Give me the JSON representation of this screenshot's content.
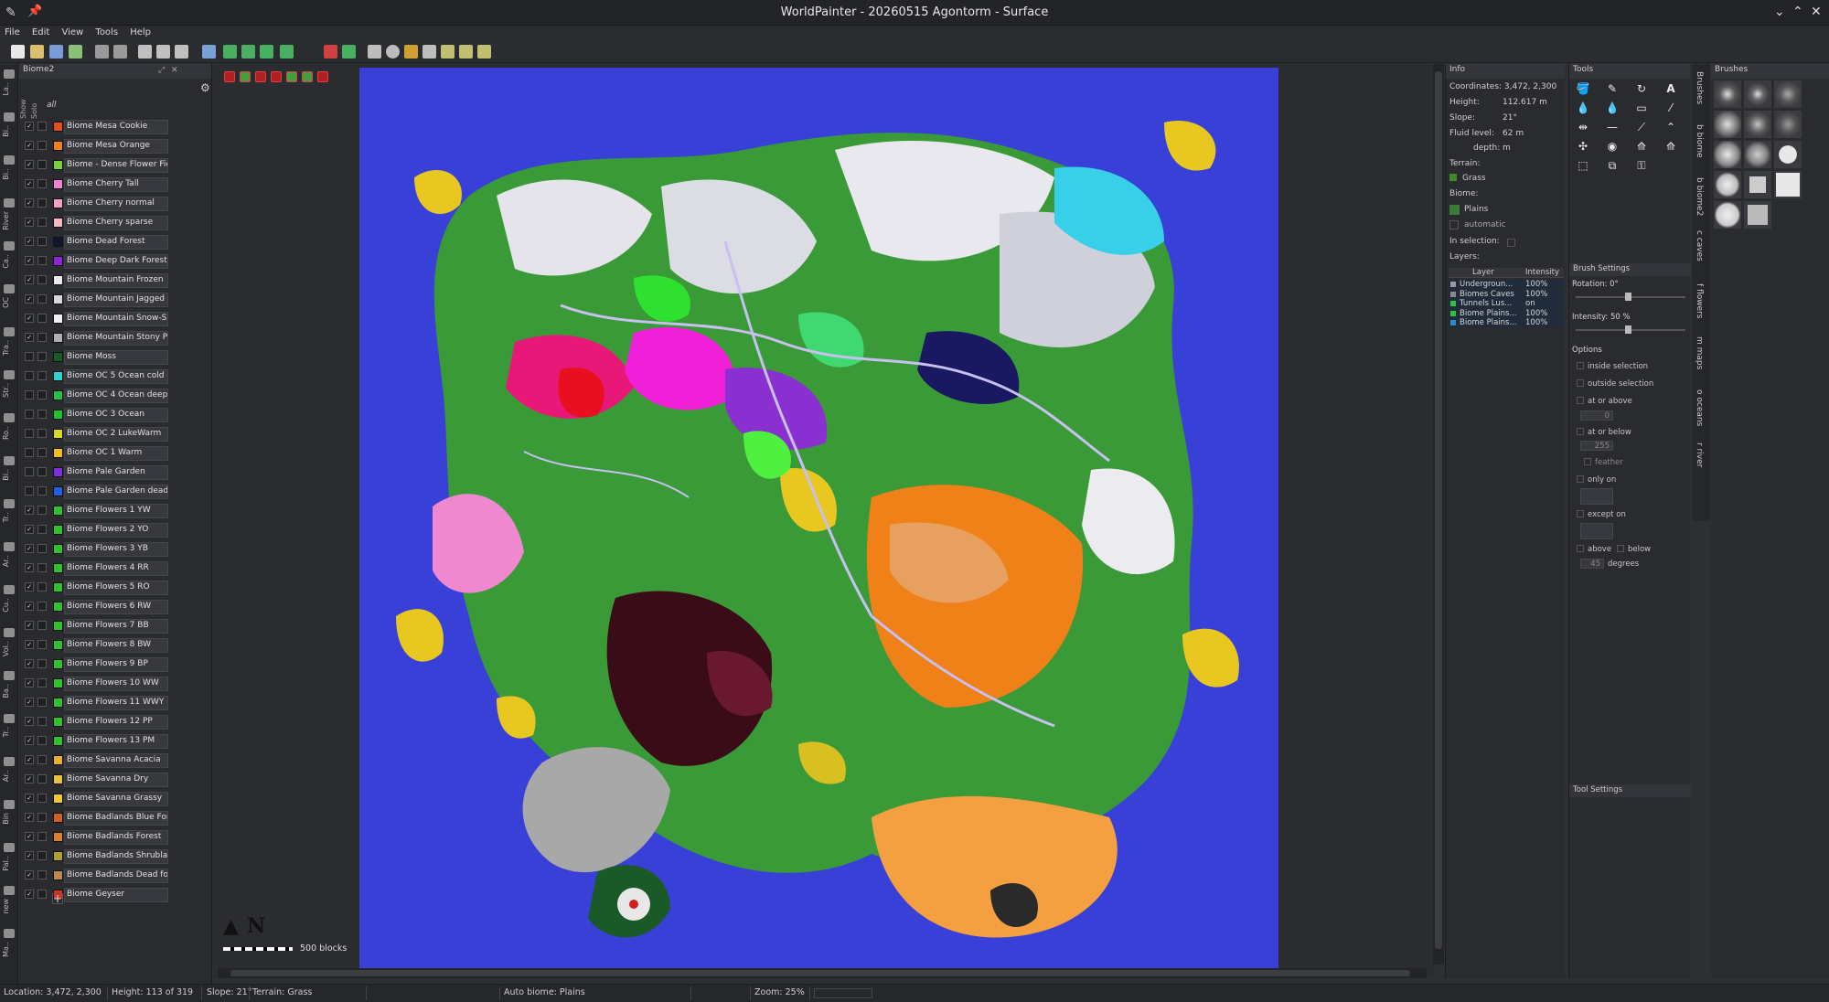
{
  "window": {
    "title": "WorldPainter - 20260515 Agontorm - Surface"
  },
  "menu": [
    "File",
    "Edit",
    "View",
    "Tools",
    "Help"
  ],
  "layers_panel": {
    "title": "Biome2",
    "column_show": "Show",
    "column_solo": "Solo",
    "all_label": "all",
    "layers": [
      {
        "name": "Biome Mesa Cookie",
        "color": "#e0501c",
        "show": true
      },
      {
        "name": "Biome Mesa Orange",
        "color": "#f08020",
        "show": true
      },
      {
        "name": "Biome - Dense Flower Fields",
        "color": "#7cd03c",
        "show": true
      },
      {
        "name": "Biome Cherry Tall",
        "color": "#f080d8",
        "show": true
      },
      {
        "name": "Biome Cherry normal",
        "color": "#f4a0c8",
        "show": true
      },
      {
        "name": "Biome Cherry sparse",
        "color": "#f6b8c0",
        "show": true
      },
      {
        "name": "Biome Dead Forest",
        "color": "#101830",
        "show": true
      },
      {
        "name": "Biome Deep Dark Forest",
        "color": "#8c24d8",
        "show": true
      },
      {
        "name": "Biome Mountain Frozen",
        "color": "#e8e8f0",
        "show": true
      },
      {
        "name": "Biome Mountain Jagged",
        "color": "#d8d8d8",
        "show": true
      },
      {
        "name": "Biome Mountain Snow-Slopes",
        "color": "#f0f0f0",
        "show": true
      },
      {
        "name": "Biome Mountain Stony Peaks",
        "color": "#b0b0b0",
        "show": true
      },
      {
        "name": "Biome Moss",
        "color": "#1a5a28",
        "show": false
      },
      {
        "name": "Biome OC 5 Ocean cold",
        "color": "#30d0d0",
        "show": false
      },
      {
        "name": "Biome OC 4 Ocean deep",
        "color": "#28c048",
        "show": false
      },
      {
        "name": "Biome OC 3 Ocean",
        "color": "#20c030",
        "show": false
      },
      {
        "name": "Biome OC 2 LukeWarm",
        "color": "#d8d820",
        "show": false
      },
      {
        "name": "Biome OC 1 Warm",
        "color": "#f0c020",
        "show": false
      },
      {
        "name": "Biome Pale Garden",
        "color": "#7a30e0",
        "show": false
      },
      {
        "name": "Biome Pale Garden dead",
        "color": "#2060e0",
        "show": false
      },
      {
        "name": "Biome Flowers 1 YW",
        "color": "#30c030",
        "show": true
      },
      {
        "name": "Biome Flowers 2 YO",
        "color": "#30c030",
        "show": true
      },
      {
        "name": "Biome Flowers 3 YB",
        "color": "#30c030",
        "show": true
      },
      {
        "name": "Biome Flowers 4 RR",
        "color": "#30c030",
        "show": true
      },
      {
        "name": "Biome Flowers 5 RO",
        "color": "#30c030",
        "show": true
      },
      {
        "name": "Biome Flowers 6 RW",
        "color": "#30c030",
        "show": true
      },
      {
        "name": "Biome Flowers 7 BB",
        "color": "#30c030",
        "show": true
      },
      {
        "name": "Biome Flowers 8 BW",
        "color": "#30c030",
        "show": true
      },
      {
        "name": "Biome Flowers 9 BP",
        "color": "#30c030",
        "show": true
      },
      {
        "name": "Biome Flowers 10 WW",
        "color": "#30c030",
        "show": true
      },
      {
        "name": "Biome Flowers  11 WWY",
        "color": "#30c030",
        "show": true
      },
      {
        "name": "Biome Flowers 12 PP",
        "color": "#30c030",
        "show": true
      },
      {
        "name": "Biome Flowers 13 PM",
        "color": "#30c030",
        "show": true
      },
      {
        "name": "Biome Savanna Acacia",
        "color": "#e8b030",
        "show": true
      },
      {
        "name": "Biome Savanna Dry",
        "color": "#e8c040",
        "show": true
      },
      {
        "name": "Biome Savanna Grassy",
        "color": "#f0c830",
        "show": true
      },
      {
        "name": "Biome Badlands Blue Forest",
        "color": "#d06020",
        "show": true
      },
      {
        "name": "Biome Badlands Forest",
        "color": "#d88030",
        "show": true
      },
      {
        "name": "Biome Badlands Shrubland",
        "color": "#b0a030",
        "show": true
      },
      {
        "name": "Biome Badlands Dead forest",
        "color": "#c08850",
        "show": true
      },
      {
        "name": "Biome Geyser",
        "color": "#e03020",
        "show": true
      }
    ]
  },
  "left_strip_labels": [
    "La..",
    "Bi..",
    "Bi..",
    "River",
    "Ca..",
    "OC",
    "Tra..",
    "Str..",
    "Ro..",
    "Bi..",
    "Tr..",
    "Ar..",
    "Cu..",
    "Vol..",
    "Ba..",
    "Tr..",
    "Ar..",
    "Bin",
    "Pal..",
    "new",
    "Ma.."
  ],
  "map": {
    "scale_label": "500 blocks",
    "compass_label": "N"
  },
  "info": {
    "title": "Info",
    "coordinates": "Coordinates: 3,472, 2,300",
    "height_label": "Height:",
    "height_value": "112.617 m",
    "slope_label": "Slope:",
    "slope_value": "21°",
    "fluid_label": "Fluid level:",
    "fluid_value": "62 m",
    "depth_label": "depth:",
    "depth_value": "m",
    "terrain_label": "Terrain:",
    "terrain_value": "Grass",
    "biome_label": "Biome:",
    "biome_value": "Plains",
    "biome_auto": "automatic",
    "selection_label": "In selection:",
    "layers_label": "Layers:",
    "table_headers": [
      "Layer",
      "Intensity"
    ],
    "table_rows": [
      {
        "name": "Undergroun...",
        "value": "100%",
        "color": "#9a9a9a"
      },
      {
        "name": "Biomes Caves",
        "value": "100%",
        "color": "#8a8a8a"
      },
      {
        "name": "Tunnels Lus...",
        "value": "on",
        "color": "#30c040"
      },
      {
        "name": "Biome Plains...",
        "value": "100%",
        "color": "#30c040"
      },
      {
        "name": "Biome Plains...",
        "value": "100%",
        "color": "#3088c0"
      }
    ]
  },
  "tools": {
    "title": "Tools"
  },
  "brush_settings": {
    "title": "Brush Settings",
    "rotation": "Rotation: 0°",
    "intensity": "Intensity: 50 %",
    "options_label": "Options",
    "options": [
      "inside selection",
      "outside selection",
      "at or above",
      "at or below",
      "feather",
      "only on",
      "except on",
      "above",
      "below",
      "degrees"
    ],
    "at_or_above_value": "0",
    "at_or_below_value": "255",
    "degrees_value": "45"
  },
  "tool_settings": {
    "title": "Tool Settings"
  },
  "brushes": {
    "title": "Brushes"
  },
  "side_tabs": [
    "Brushes",
    "b biome",
    "b biome2",
    "c caves",
    "f flowers",
    "m maps",
    "o oceans",
    "r river"
  ],
  "status": {
    "location": "Location: 3,472, 2,300",
    "height": "Height: 113 of 319",
    "slope": "Slope: 21°",
    "terrain": "Terrain: Grass",
    "biome": "Auto biome: Plains",
    "zoom": "Zoom: 25%"
  }
}
